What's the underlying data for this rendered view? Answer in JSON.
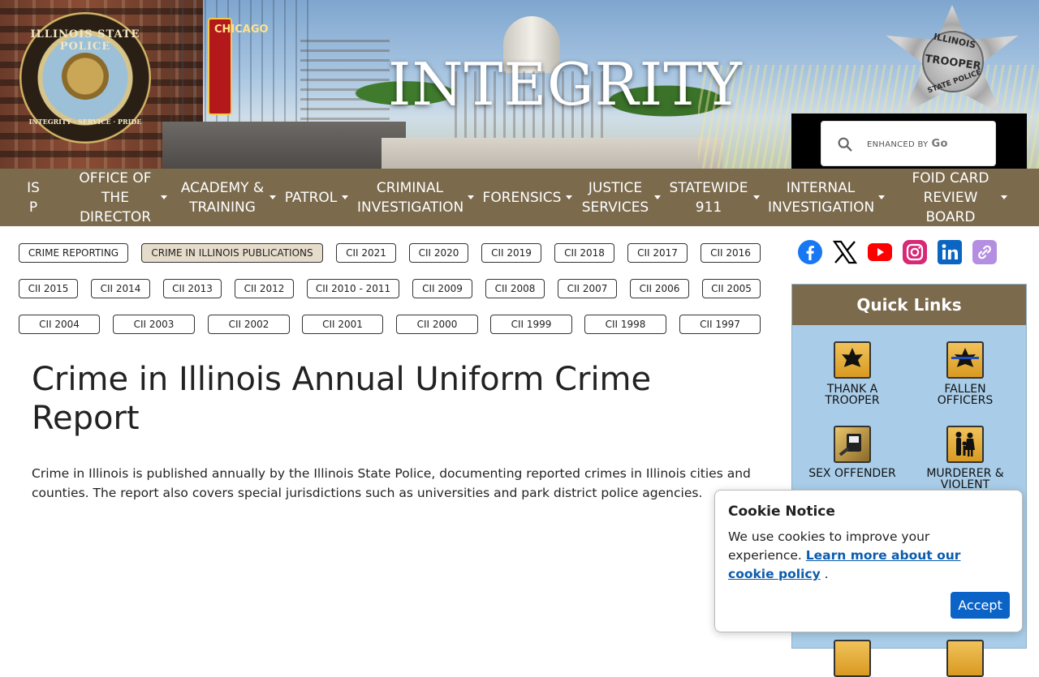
{
  "header": {
    "banner_title": "INTEGRITY",
    "seal": {
      "top_text": "ILLINOIS STATE POLICE",
      "bottom_text": "INTEGRITY · SERVICE · PRIDE"
    },
    "theater_sign": "CHICAGO",
    "badge": {
      "line1": "ILLINOIS",
      "line2": "TROOPER",
      "line3": "STATE POLICE"
    },
    "search": {
      "brand_prefix": "ENHANCED BY",
      "brand_name": "Go"
    }
  },
  "nav": {
    "items": [
      {
        "label": "IS P",
        "has_dropdown": false
      },
      {
        "label": "OFFICE OF THE DIRECTOR",
        "has_dropdown": true
      },
      {
        "label": "ACADEMY & TRAINING",
        "has_dropdown": true
      },
      {
        "label": "PATROL",
        "has_dropdown": true
      },
      {
        "label": "CRIMINAL INVESTIGATION",
        "has_dropdown": true
      },
      {
        "label": "FORENSICS",
        "has_dropdown": true
      },
      {
        "label": "JUSTICE SERVICES",
        "has_dropdown": true
      },
      {
        "label": "STATEWIDE 911",
        "has_dropdown": true
      },
      {
        "label": "INTERNAL INVESTIGATION",
        "has_dropdown": true
      },
      {
        "label": "FOID CARD REVIEW BOARD",
        "has_dropdown": true
      }
    ]
  },
  "subnav": {
    "active": "CRIME IN ILLINOIS PUBLICATIONS",
    "pills": [
      "CRIME REPORTING",
      "CRIME IN ILLINOIS PUBLICATIONS",
      "CII 2021",
      "CII 2020",
      "CII 2019",
      "CII 2018",
      "CII 2017",
      "CII 2016",
      "CII 2015",
      "CII 2014",
      "CII 2013",
      "CII 2012",
      "CII 2010 - 2011",
      "CII 2009",
      "CII 2008",
      "CII 2007",
      "CII 2006",
      "CII 2005",
      "CII 2004",
      "CII 2003",
      "CII 2002",
      "CII 2001",
      "CII 2000",
      "CII 1999",
      "CII 1998",
      "CII 1997"
    ]
  },
  "main": {
    "title": "Crime in Illinois Annual Uniform Crime Report",
    "intro": "Crime in Illinois is published annually by the Illinois State Police, documenting reported crimes in Illinois cities and counties. The report also covers special jurisdictions such as universities and park district police agencies."
  },
  "social": {
    "icons": [
      "facebook-icon",
      "x-icon",
      "youtube-icon",
      "instagram-icon",
      "linkedin-icon",
      "link-icon"
    ],
    "colors": {
      "facebook": "#1877f2",
      "x": "#000000",
      "youtube": "#ff0000",
      "instagram": "#d62976",
      "linkedin": "#0a66c2",
      "link": "#b48ee0"
    }
  },
  "quick_links": {
    "heading": "Quick Links",
    "items": [
      {
        "label": "THANK A TROOPER",
        "icon": "star-badge-icon"
      },
      {
        "label": "FALLEN OFFICERS",
        "icon": "mourning-badge-icon"
      },
      {
        "label": "SEX OFFENDER",
        "icon": "offender-registry-icon"
      },
      {
        "label": "MURDERER & VIOLENT",
        "icon": "family-icon"
      }
    ]
  },
  "cookie": {
    "title": "Cookie Notice",
    "text": "We use cookies to improve your experience.",
    "link_text": "Learn more about our cookie policy",
    "after_link": ".",
    "accept_label": "Accept"
  },
  "colors": {
    "nav_bg": "#7b6a4c",
    "quick_links_bg": "#a9cde9",
    "active_pill": "#e6dccb",
    "accept_button": "#0b63c8",
    "link": "#0b5cad"
  }
}
